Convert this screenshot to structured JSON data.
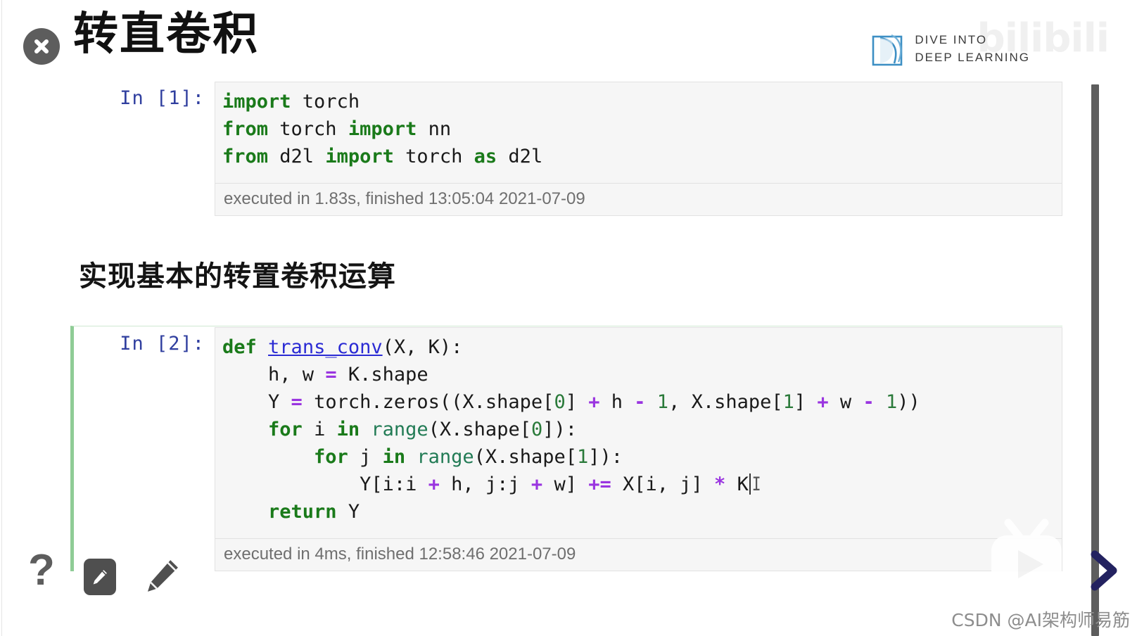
{
  "header": {
    "title": "转直卷积",
    "close_icon": "close-circle-icon"
  },
  "brand": {
    "line1": "DIVE INTO",
    "line2": "DEEP LEARNING",
    "mark_icon": "d2l-book-icon",
    "watermark": "bilibili"
  },
  "notebook": {
    "cells": [
      {
        "prompt": "In [1]:",
        "exec_info": "executed in 1.83s, finished 13:05:04 2021-07-09",
        "selected": false
      },
      {
        "prompt": "In [2]:",
        "exec_info": "executed in 4ms, finished 12:58:46 2021-07-09",
        "selected": true
      }
    ],
    "markdown_heading": "实现基本的转置卷积运算",
    "code_cell_1_lines": [
      "import torch",
      "from torch import nn",
      "from d2l import torch as d2l"
    ],
    "code_cell_2_lines": [
      "def trans_conv(X, K):",
      "    h, w = K.shape",
      "    Y = torch.zeros((X.shape[0] + h - 1, X.shape[1] + w - 1))",
      "    for i in range(X.shape[0]):",
      "        for j in range(X.shape[1]):",
      "            Y[i:i + h, j:j + w] += X[i, j] * K",
      "    return Y"
    ]
  },
  "toolbar": {
    "help_label": "?",
    "pen_button_icon": "pencil-square-icon",
    "pen_icon": "pencil-icon"
  },
  "player": {
    "play_icon": "bilibili-play-icon",
    "next_icon": "chevron-right-icon"
  },
  "watermark": {
    "csdn": "CSDN @AI架构师易筋"
  },
  "colors": {
    "accent_green": "#8fcc96",
    "keyword": "#1a7a1a",
    "function": "#2b2bd4",
    "number": "#2a7a3a",
    "operator": "#9a35e0",
    "prompt": "#303f9f",
    "brand_blue": "#3d8fc4",
    "scrollbar": "#5d5d5d"
  }
}
